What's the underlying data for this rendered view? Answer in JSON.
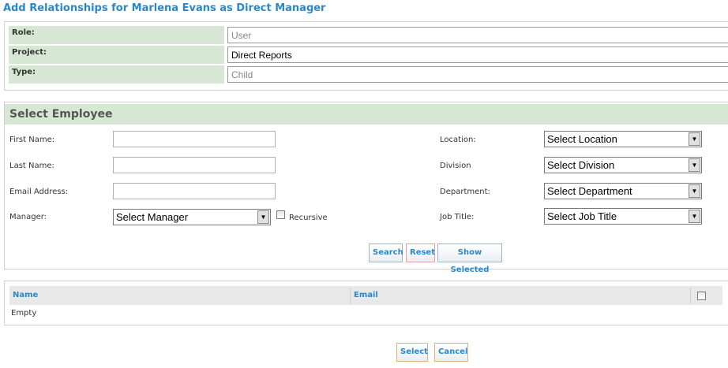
{
  "page": {
    "title": "Add Relationships for Marlena Evans as Direct Manager"
  },
  "info": {
    "role_label": "Role:",
    "role_value": "User",
    "project_label": "Project:",
    "project_value": "Direct Reports",
    "type_label": "Type:",
    "type_value": "Child"
  },
  "employee": {
    "header": "Select Employee",
    "first_name_label": "First Name:",
    "first_name_value": "",
    "last_name_label": "Last Name:",
    "last_name_value": "",
    "email_label": "Email Address:",
    "email_value": "",
    "manager_label": "Manager:",
    "manager_value": "Select Manager",
    "recursive_label": "Recursive",
    "location_label": "Location:",
    "location_value": "Select Location",
    "division_label": "Division",
    "division_value": "Select Division",
    "department_label": "Department:",
    "department_value": "Select Department",
    "job_title_label": "Job Title:",
    "job_title_value": "Select Job Title",
    "search_button": "Search",
    "reset_button": "Reset",
    "show_selected_button": "Show Selected"
  },
  "grid": {
    "columns": [
      "Name",
      "Email"
    ],
    "empty_text": "Empty"
  },
  "footer": {
    "select_button": "Select",
    "cancel_button": "Cancel"
  },
  "colors": {
    "accent": "#2a88c8",
    "header_bg": "#d6e8d3"
  }
}
